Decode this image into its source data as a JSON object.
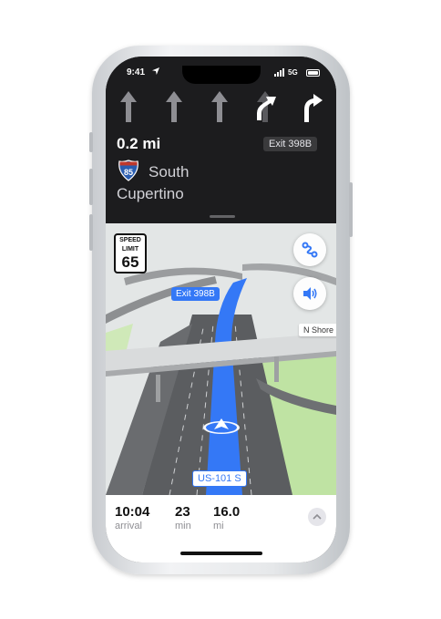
{
  "status_bar": {
    "time": "9:41",
    "network": "5G"
  },
  "guidance": {
    "lanes": [
      "straight",
      "straight",
      "straight",
      "straight-right",
      "right"
    ],
    "distance": "0.2 mi",
    "exit": "Exit 398B",
    "shield_number": "85",
    "direction": "South",
    "destination": "Cupertino"
  },
  "map": {
    "speed_label_line1": "SPEED",
    "speed_label_line2": "LIMIT",
    "speed_value": "65",
    "exit_callout": "Exit 398B",
    "street_callout": "N Shore",
    "route_label": "US-101 S"
  },
  "trip": {
    "arrival_value": "10:04",
    "arrival_unit": "arrival",
    "minutes_value": "23",
    "minutes_unit": "min",
    "miles_value": "16.0",
    "miles_unit": "mi"
  },
  "colors": {
    "route": "#3478f6",
    "dark_bg": "#1c1c1e",
    "grass": "#bfe3a3"
  },
  "icons": [
    "location-arrow-icon",
    "signal-icon",
    "battery-icon",
    "lane-arrow-icon",
    "highway-shield-icon",
    "route-overview-icon",
    "audio-icon",
    "user-location-icon",
    "chevron-up-icon"
  ]
}
